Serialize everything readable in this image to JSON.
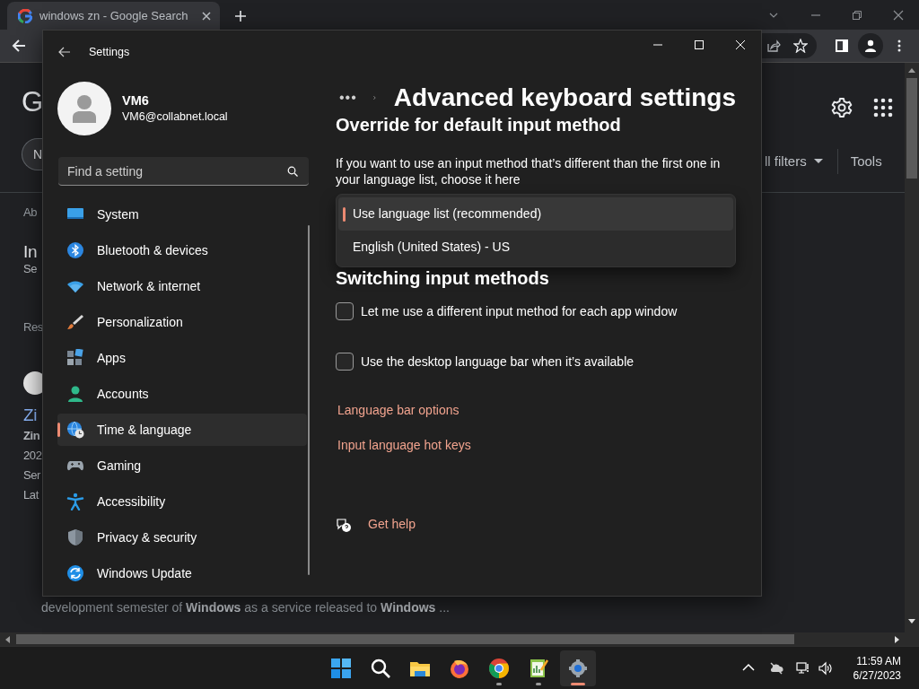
{
  "browser": {
    "tab": {
      "title": "windows zn - Google Search"
    },
    "page": {
      "logo_fragment": "G",
      "chip_fragment": "N",
      "filters_fragment": "ll filters",
      "tools": "Tools",
      "left_fragments": [
        {
          "text": "Ab",
          "kind": "label"
        },
        {
          "text": "In",
          "kind": "title"
        },
        {
          "text": "Se",
          "kind": "meta"
        },
        {
          "text": "Res",
          "kind": "label"
        },
        {
          "text": "Zi",
          "kind": "result-title"
        },
        {
          "text": "Zin",
          "kind": "bold"
        },
        {
          "text": "202",
          "kind": "meta"
        },
        {
          "text": "Ser",
          "kind": "meta"
        },
        {
          "text": "Lat",
          "kind": "meta"
        }
      ],
      "snippet": "development semester of **Windows** as a service released to **Windows** ..."
    }
  },
  "settings": {
    "title": "Settings",
    "user": {
      "name": "VM6",
      "email": "VM6@collabnet.local"
    },
    "search": {
      "placeholder": "Find a setting"
    },
    "nav": [
      {
        "label": "System",
        "selected": false
      },
      {
        "label": "Bluetooth & devices",
        "selected": false
      },
      {
        "label": "Network & internet",
        "selected": false
      },
      {
        "label": "Personalization",
        "selected": false
      },
      {
        "label": "Apps",
        "selected": false
      },
      {
        "label": "Accounts",
        "selected": false
      },
      {
        "label": "Time & language",
        "selected": true
      },
      {
        "label": "Gaming",
        "selected": false
      },
      {
        "label": "Accessibility",
        "selected": false
      },
      {
        "label": "Privacy & security",
        "selected": false
      },
      {
        "label": "Windows Update",
        "selected": false
      }
    ],
    "breadcrumb": {
      "ellipsis": "•••",
      "title": "Advanced keyboard settings"
    },
    "override": {
      "heading": "Override for default input method",
      "description": "If you want to use an input method that’s different than the first one in your language list, choose it here",
      "options": [
        {
          "label": "Use language list (recommended)",
          "selected": true
        },
        {
          "label": "English (United States) - US",
          "selected": false
        }
      ]
    },
    "switching": {
      "heading": "Switching input methods",
      "options": [
        {
          "label": "Let me use a different input method for each app window",
          "checked": false
        },
        {
          "label": "Use the desktop language bar when it’s available",
          "checked": false
        }
      ]
    },
    "links": [
      "Language bar options",
      "Input language hot keys"
    ],
    "help": "Get help"
  },
  "taskbar": {
    "apps": [
      {
        "kind": "start",
        "running": false,
        "selected": false
      },
      {
        "kind": "search",
        "running": false,
        "selected": false
      },
      {
        "kind": "explorer",
        "running": false,
        "selected": false
      },
      {
        "kind": "firefox",
        "running": false,
        "selected": false
      },
      {
        "kind": "chrome",
        "running": true,
        "selected": false
      },
      {
        "kind": "notepad",
        "running": true,
        "selected": false
      },
      {
        "kind": "settings",
        "running": true,
        "selected": true
      }
    ],
    "clock": {
      "time": "11:59 AM",
      "date": "6/27/2023"
    }
  }
}
